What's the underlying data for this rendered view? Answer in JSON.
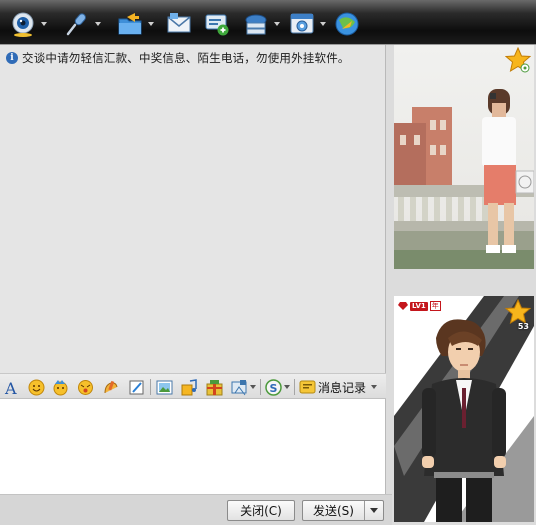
{
  "toolbar": {
    "items": [
      {
        "name": "webcam",
        "icon": "webcam-icon",
        "has_menu": true
      },
      {
        "name": "voice",
        "icon": "microphone-icon",
        "has_menu": true
      },
      {
        "name": "transfer-file",
        "icon": "folder-transfer-icon",
        "has_menu": true
      },
      {
        "name": "send-mail",
        "icon": "mail-icon",
        "has_menu": false
      },
      {
        "name": "create-discussion",
        "icon": "add-contact-icon",
        "has_menu": false
      },
      {
        "name": "remote-assist",
        "icon": "remote-assist-icon",
        "has_menu": true
      },
      {
        "name": "app-center",
        "icon": "apps-icon",
        "has_menu": true
      },
      {
        "name": "share",
        "icon": "globe-share-icon",
        "has_menu": false
      }
    ]
  },
  "chat": {
    "notice": "交谈中请勿轻信汇款、中奖信息、陌生电话，勿使用外挂软件。"
  },
  "format_bar": {
    "history_label": "消息记录",
    "items": [
      "font-icon",
      "emoticon-icon",
      "magic-emoticon-icon",
      "nudge-icon",
      "doodle-icon",
      "handwriting-icon",
      "image-icon",
      "music-icon",
      "gift-icon",
      "screenshot-icon",
      "payment-icon",
      "history-icon"
    ]
  },
  "buttons": {
    "close": "关闭(C)",
    "send": "发送(S)"
  },
  "profile": {
    "level_tag": "LV1",
    "level_sub": "年",
    "star_count": "53"
  },
  "colors": {
    "toolbar_dark": "#0d0d0d",
    "chat_bg": "#e5e5e5",
    "notice_icon": "#2f6bb7",
    "vip_red": "#c4161c",
    "star_gold": "#f7b51c"
  }
}
